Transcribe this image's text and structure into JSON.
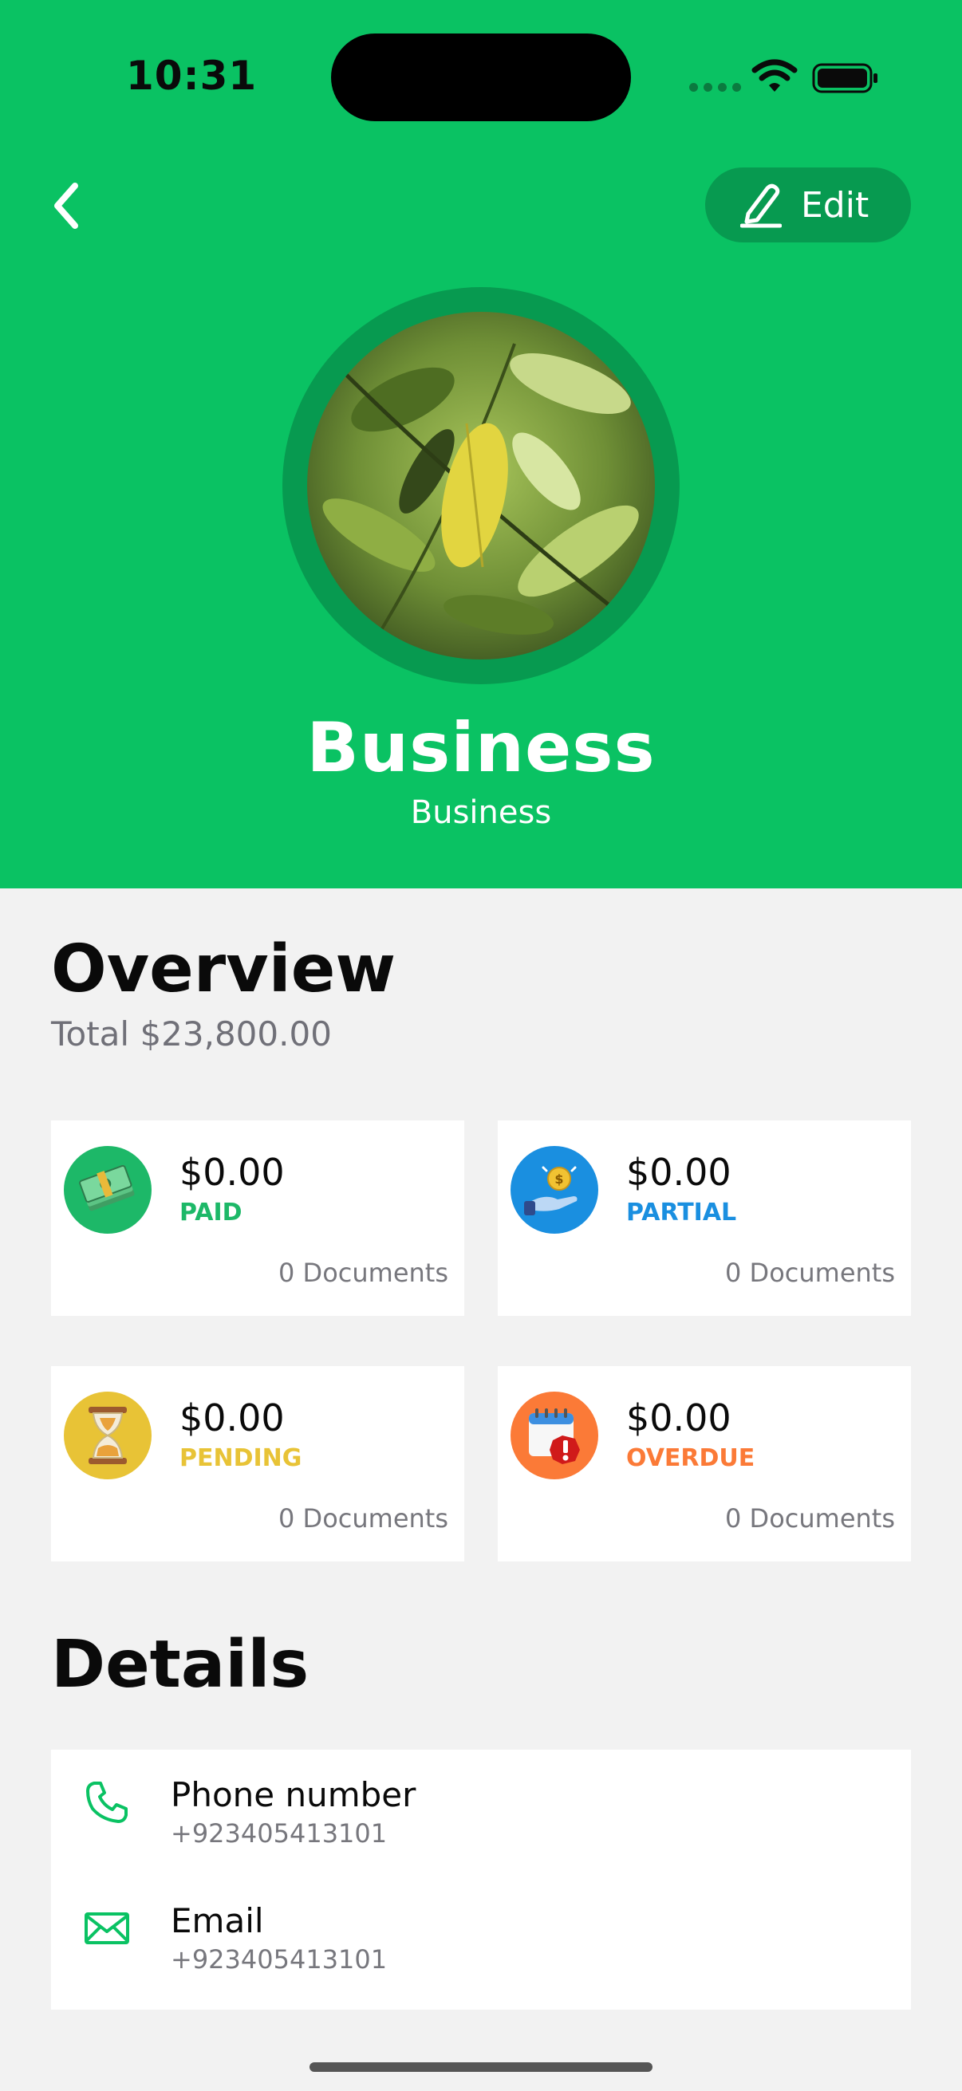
{
  "status_bar": {
    "time": "10:31"
  },
  "header": {
    "back_icon": "chevron-left-icon",
    "edit_label": "Edit",
    "edit_icon": "pencil-icon",
    "name": "Business",
    "subtitle": "Business",
    "brand_color": "#0ac263"
  },
  "overview": {
    "title": "Overview",
    "total": "Total $23,800.00",
    "cards": [
      {
        "amount": "$0.00",
        "status": "PAID",
        "documents": "0 Documents",
        "color": "#1db868",
        "icon": "cash-stack-icon"
      },
      {
        "amount": "$0.00",
        "status": "PARTIAL",
        "documents": "0 Documents",
        "color": "#1a8fe0",
        "icon": "hand-coin-icon"
      },
      {
        "amount": "$0.00",
        "status": "PENDING",
        "documents": "0 Documents",
        "color": "#e8c336",
        "icon": "hourglass-icon"
      },
      {
        "amount": "$0.00",
        "status": "OVERDUE",
        "documents": "0 Documents",
        "color": "#fb7a37",
        "icon": "calendar-alert-icon"
      }
    ]
  },
  "details": {
    "title": "Details",
    "rows": [
      {
        "label": "Phone number",
        "value": "+923405413101",
        "icon": "phone-icon"
      },
      {
        "label": "Email",
        "value": "+923405413101",
        "icon": "mail-icon"
      }
    ]
  }
}
